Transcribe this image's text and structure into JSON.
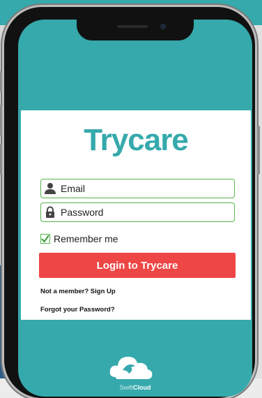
{
  "app": {
    "brand": "Trycare",
    "email_placeholder": "Email",
    "password_placeholder": "Password",
    "remember_label": "Remember me",
    "login_button": "Login to Trycare",
    "signup_link": "Not a member? Sign Up",
    "forgot_link": "Forgot your Password?",
    "remember_checked": true
  },
  "footer": {
    "brand_prefix": "Swift",
    "brand_suffix": "Cloud"
  },
  "icons": {
    "email": "user-icon",
    "password": "lock-icon",
    "checkbox": "checkmark-icon",
    "footer_logo": "cloud-bird-logo"
  },
  "colors": {
    "teal": "#35a9ac",
    "green_border": "#56b44a",
    "button_red": "#ee4545"
  }
}
